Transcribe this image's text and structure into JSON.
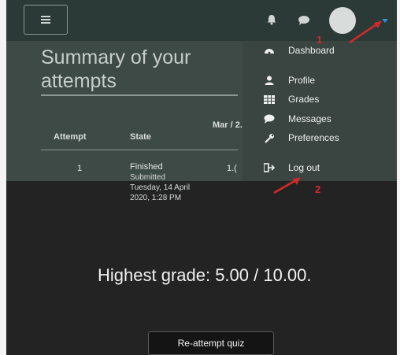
{
  "navbar": {
    "menu_icon": "hamburger-icon",
    "notifications_icon": "bell-icon",
    "messages_icon": "chat-icon",
    "user_menu_icon": "caret-down-icon"
  },
  "summary": {
    "title": "Summary of your attempts",
    "table": {
      "headers": {
        "attempt": "Attempt",
        "state": "State",
        "marks": "Mar / 2."
      },
      "rows": [
        {
          "attempt": "1",
          "state": "Finished",
          "submitted": "Submitted Tuesday, 14 April 2020, 1:28 PM",
          "marks": "1.("
        }
      ]
    }
  },
  "user_menu": {
    "items": [
      {
        "label": "Dashboard",
        "icon": "dashboard-icon"
      },
      {
        "label": "Profile",
        "icon": "user-icon"
      },
      {
        "label": "Grades",
        "icon": "grid-icon"
      },
      {
        "label": "Messages",
        "icon": "chat-icon"
      },
      {
        "label": "Preferences",
        "icon": "wrench-icon"
      },
      {
        "label": "Log out",
        "icon": "logout-icon"
      }
    ]
  },
  "annotations": {
    "step1": "1",
    "step2": "2",
    "color": "#d62a2a"
  },
  "result": {
    "highest_grade": "Highest grade: 5.00 / 10.00.",
    "reattempt_label": "Re-attempt quiz"
  }
}
